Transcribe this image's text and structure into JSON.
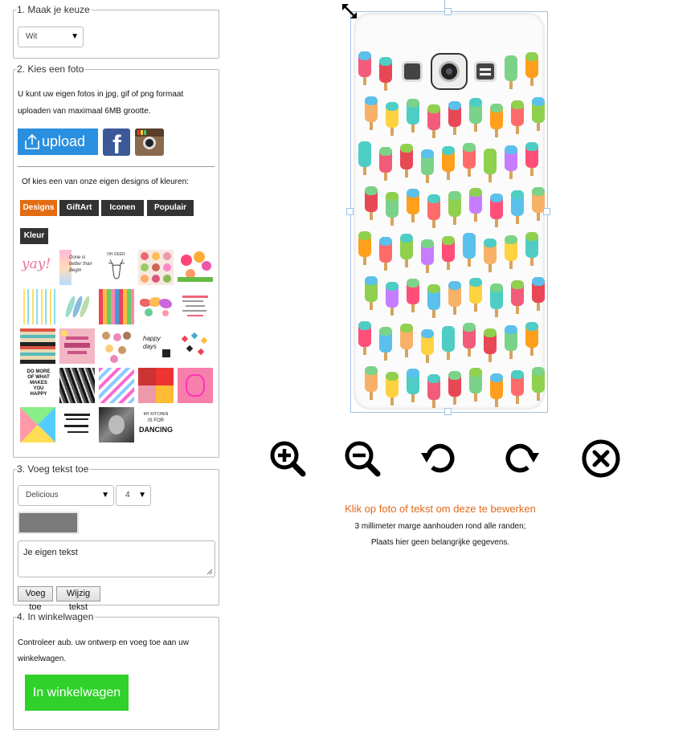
{
  "step1": {
    "legend": "1. Maak je keuze",
    "select_value": "Wit"
  },
  "step2": {
    "legend": "2. Kies een foto",
    "description_line1": "U kunt uw eigen fotos in jpg, gif of png formaat",
    "description_line2": "uploaden van maximaal 6MB grootte.",
    "upload_label": "upload",
    "designs_intro": "Of kies een van onze eigen designs of kleuren:",
    "tabs": [
      {
        "label": "Designs",
        "active": true
      },
      {
        "label": "GiftArt",
        "active": false
      },
      {
        "label": "Iconen",
        "active": false
      },
      {
        "label": "Populair",
        "active": false
      },
      {
        "label": "Kleur",
        "active": false
      }
    ],
    "thumb_texts": {
      "yay": "yay!",
      "done": "Done is better than Begin",
      "oh_deer": "OH DEER",
      "happy_days": "happy days",
      "do_more": "DO MORE OF WHAT MAKES YOU HAPPY",
      "kitchen_1": "MY KITCHEN",
      "kitchen_2": "IS FOR",
      "kitchen_3": "DANCING"
    }
  },
  "step3": {
    "legend": "3. Voeg tekst toe",
    "font_value": "Delicious",
    "size_value": "4",
    "text_value": "Je eigen tekst",
    "add_button": "Voeg toe",
    "edit_button": "Wijzig tekst"
  },
  "step4": {
    "legend": "4. In winkelwagen",
    "line1": "Controleer aub. uw ontwerp en voeg toe aan uw",
    "line2": "winkelwagen.",
    "cart_button": "In winkelwagen"
  },
  "editor": {
    "hint_main": "Klik op foto of tekst om deze te bewerken",
    "hint_line1": "3 millimeter marge aanhouden rond alle randen;",
    "hint_line2": "Plaats hier geen belangrijke gegevens.",
    "tools": [
      "zoom-in-icon",
      "zoom-out-icon",
      "rotate-left-icon",
      "rotate-right-icon",
      "delete-icon"
    ]
  },
  "colors": {
    "accent_orange": "#e36b12",
    "upload_blue": "#2b8fe0",
    "cart_green": "#2fd12a",
    "tab_dark": "#333333",
    "hint_orange": "#e06a1b"
  }
}
